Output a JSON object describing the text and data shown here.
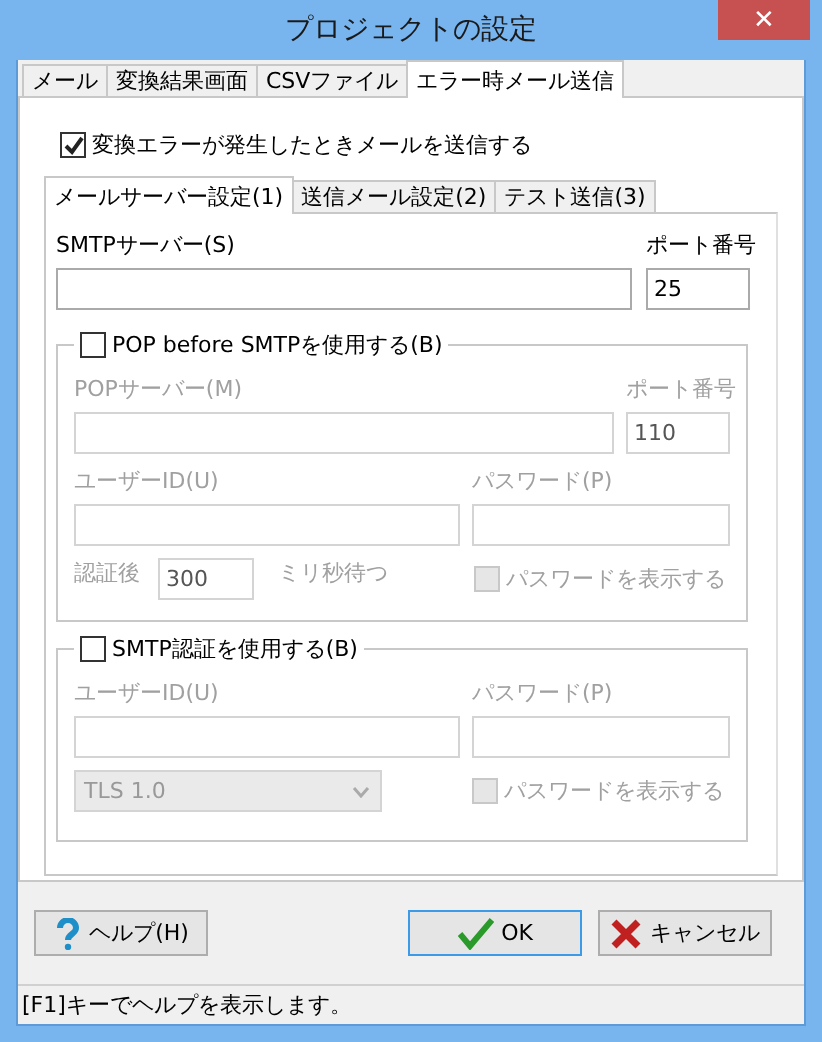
{
  "window": {
    "title": "プロジェクトの設定",
    "close": "✕"
  },
  "tabs": [
    {
      "label": "メール",
      "selected": false
    },
    {
      "label": "変換結果画面",
      "selected": false
    },
    {
      "label": "CSVファイル",
      "selected": false
    },
    {
      "label": "エラー時メール送信",
      "selected": true
    }
  ],
  "send_on_error": {
    "label": "変換エラーが発生したときメールを送信する",
    "checked": true
  },
  "inner_tabs": [
    {
      "label": "メールサーバー設定(1)",
      "selected": true
    },
    {
      "label": "送信メール設定(2)",
      "selected": false
    },
    {
      "label": "テスト送信(3)",
      "selected": false
    }
  ],
  "smtp_server": {
    "label": "SMTPサーバー(S)"
  },
  "smtp_port": {
    "label": "ポート番号",
    "value": "25"
  },
  "pop_group": {
    "label": "POP before SMTPを使用する(B)",
    "checked": false,
    "server": {
      "label": "POPサーバー(M)"
    },
    "port": {
      "label": "ポート番号",
      "value": "110"
    },
    "user": {
      "label": "ユーザーID(U)"
    },
    "password": {
      "label": "パスワード(P)"
    },
    "wait_prefix": "認証後",
    "wait_value": "300",
    "wait_suffix": "ミリ秒待つ",
    "show_password": {
      "label": "パスワードを表示する",
      "checked": false
    }
  },
  "auth_group": {
    "label": "SMTP認証を使用する(B)",
    "checked": false,
    "user": {
      "label": "ユーザーID(U)"
    },
    "password": {
      "label": "パスワード(P)"
    },
    "tls": "TLS 1.0",
    "show_password": {
      "label": "パスワードを表示する",
      "checked": false
    }
  },
  "buttons": [
    {
      "kind": "help",
      "label": "ヘルプ(H)",
      "default": false
    },
    {
      "kind": "ok",
      "label": "OK",
      "default": true
    },
    {
      "kind": "cancel",
      "label": "キャンセル",
      "default": false
    }
  ],
  "status_bar": "[F1]キーでヘルプを表示します。"
}
